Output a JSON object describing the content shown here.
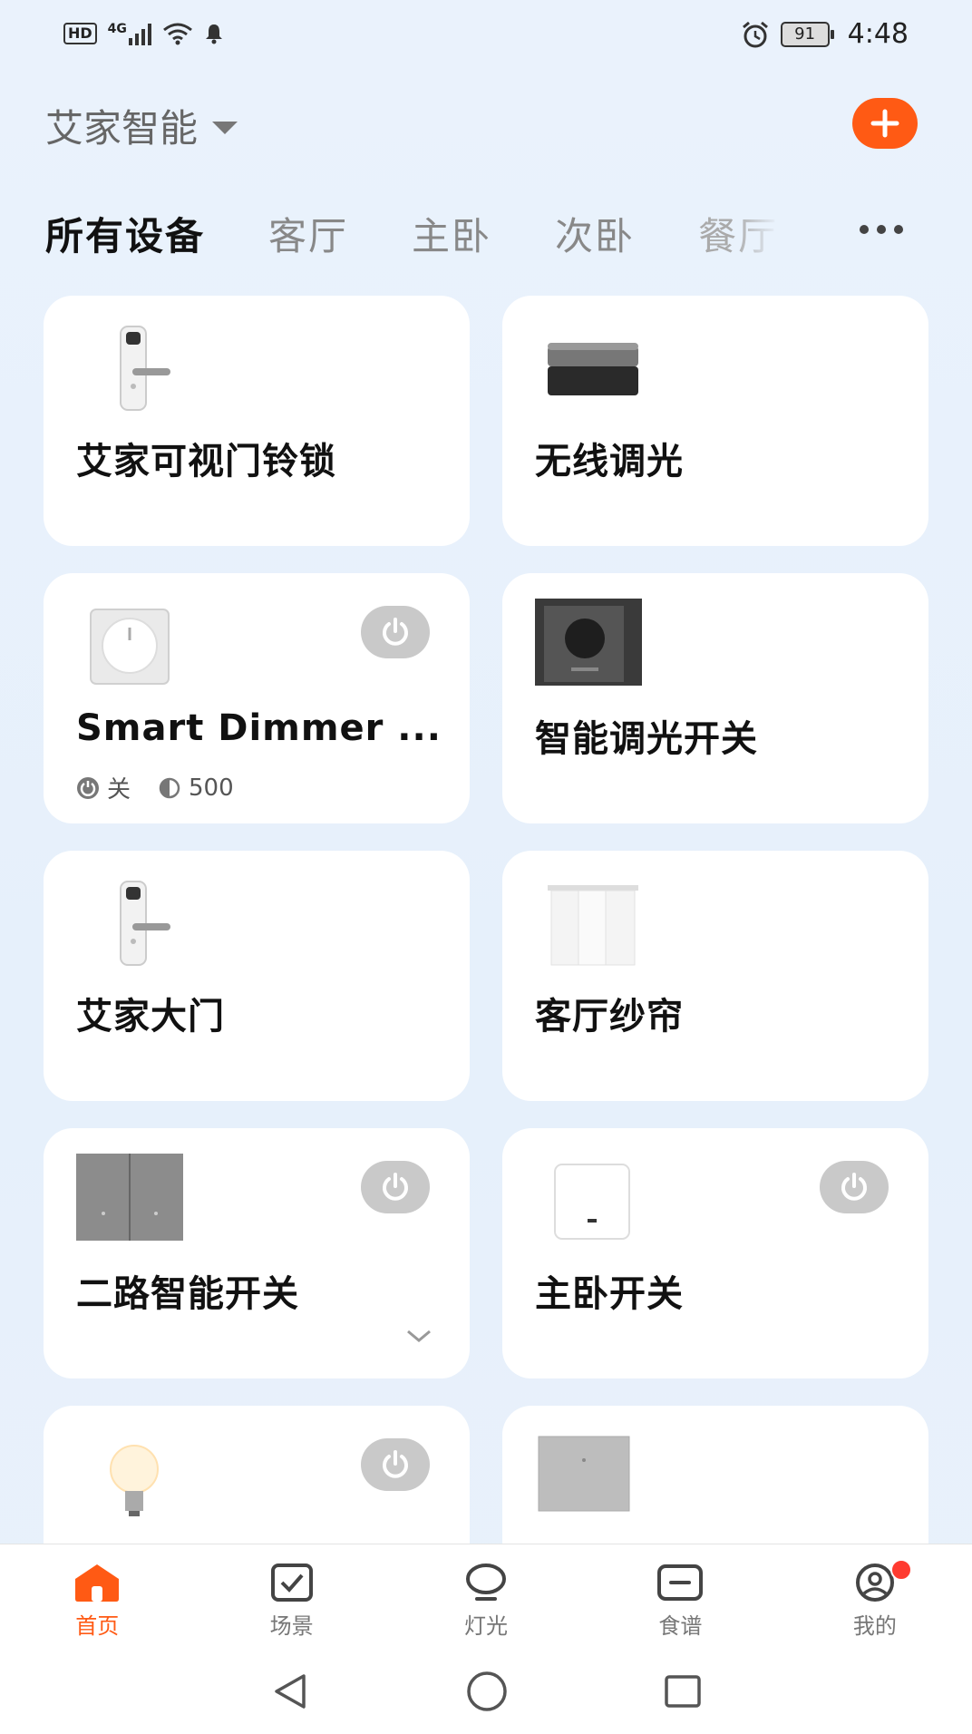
{
  "status_bar": {
    "hd": "HD",
    "network": "4G",
    "battery": "91",
    "time": "4:48"
  },
  "header": {
    "home_name": "艾家智能"
  },
  "tabs": [
    "所有设备",
    "客厅",
    "主卧",
    "次卧",
    "餐厅"
  ],
  "devices": [
    {
      "name": "艾家可视门铃锁",
      "icon": "door-lock-icon"
    },
    {
      "name": "无线调光",
      "icon": "wireless-dimmer-icon"
    },
    {
      "name": "Smart Dimmer ...",
      "icon": "dimmer-switch-icon",
      "status_power": "关",
      "status_brightness": "500"
    },
    {
      "name": "智能调光开关",
      "icon": "smart-dimmer-knob-icon"
    },
    {
      "name": "艾家大门",
      "icon": "door-lock-icon"
    },
    {
      "name": "客厅纱帘",
      "icon": "curtain-icon"
    },
    {
      "name": "二路智能开关",
      "icon": "two-gang-switch-icon"
    },
    {
      "name": "主卧开关",
      "icon": "wall-switch-icon"
    },
    {
      "name": "",
      "icon": "light-bulb-icon"
    },
    {
      "name": "",
      "icon": "switch-panel-icon"
    }
  ],
  "bottom_nav": [
    {
      "label": "首页",
      "icon": "home-icon",
      "active": true
    },
    {
      "label": "场景",
      "icon": "scene-icon"
    },
    {
      "label": "灯光",
      "icon": "light-icon"
    },
    {
      "label": "食谱",
      "icon": "recipe-icon"
    },
    {
      "label": "我的",
      "icon": "profile-icon"
    }
  ],
  "colors": {
    "accent": "#ff5a14",
    "background": "#e8f1fc",
    "power_button": "#c9c9c9"
  }
}
